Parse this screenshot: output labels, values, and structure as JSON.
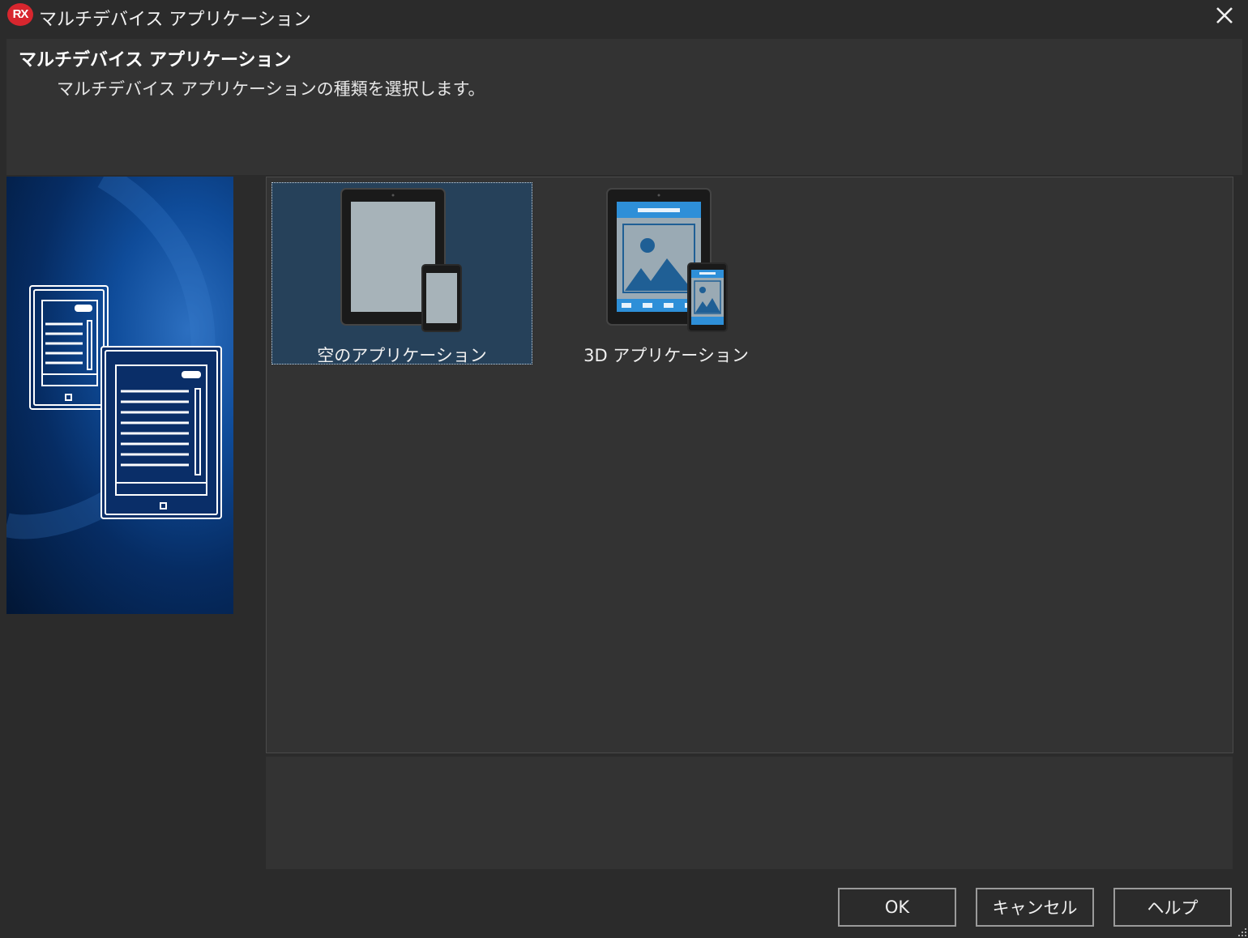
{
  "window": {
    "title": "マルチデバイス アプリケーション",
    "logo_text": "RX",
    "close_icon": "close-icon"
  },
  "header": {
    "title": "マルチデバイス アプリケーション",
    "description": "マルチデバイス アプリケーションの種類を選択します。"
  },
  "templates": [
    {
      "label": "空のアプリケーション",
      "icon": "blank-app-icon",
      "selected": true
    },
    {
      "label": "3D アプリケーション",
      "icon": "3d-app-icon",
      "selected": false
    }
  ],
  "description_panel": {
    "text": ""
  },
  "buttons": {
    "ok": "OK",
    "cancel": "キャンセル",
    "help": "ヘルプ"
  },
  "colors": {
    "background": "#2b2b2b",
    "panel": "#333333",
    "selection": "#26415a",
    "logo": "#d7262e",
    "accent_blue": "#2e8fd8"
  }
}
